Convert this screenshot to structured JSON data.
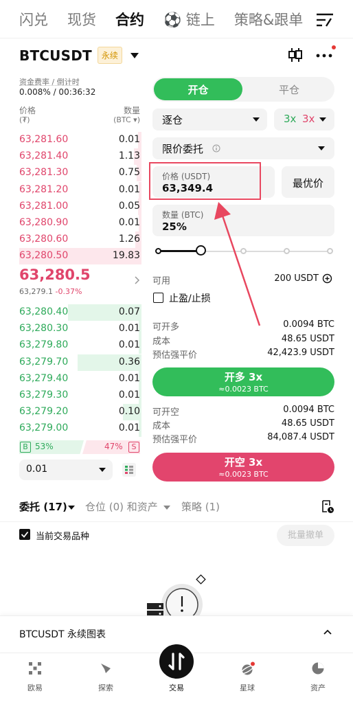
{
  "top_nav": {
    "tabs": [
      "闪兑",
      "现货",
      "合约",
      "⚽ 链上",
      "策略&跟单"
    ],
    "active_index": 2
  },
  "symbol": {
    "name": "BTCUSDT",
    "badge": "永续"
  },
  "funding": {
    "label": "资金费率 / 倒计时",
    "value": "0.008% / 00:36:32"
  },
  "orderbook": {
    "price_header": "价格",
    "price_unit": "(₮)",
    "qty_header": "数量",
    "qty_unit": "(BTC ▾)",
    "asks": [
      {
        "price": "63,281.60",
        "qty": "0.01",
        "depth": 0.03
      },
      {
        "price": "63,281.40",
        "qty": "1.13",
        "depth": 0.06
      },
      {
        "price": "63,281.30",
        "qty": "0.75",
        "depth": 0.04
      },
      {
        "price": "63,281.20",
        "qty": "0.01",
        "depth": 0.02
      },
      {
        "price": "63,281.00",
        "qty": "0.05",
        "depth": 0.03
      },
      {
        "price": "63,280.90",
        "qty": "0.01",
        "depth": 0.02
      },
      {
        "price": "63,280.60",
        "qty": "1.26",
        "depth": 0.05
      },
      {
        "price": "63,280.50",
        "qty": "19.83",
        "depth": 1.0
      }
    ],
    "last_price": "63,280.5",
    "mark_price": "63,279.1",
    "change": "-0.37%",
    "bids": [
      {
        "price": "63,280.40",
        "qty": "0.07",
        "depth": 0.6
      },
      {
        "price": "63,280.30",
        "qty": "0.01",
        "depth": 0.02
      },
      {
        "price": "63,279.80",
        "qty": "0.01",
        "depth": 0.02
      },
      {
        "price": "63,279.70",
        "qty": "0.36",
        "depth": 0.52
      },
      {
        "price": "63,279.40",
        "qty": "0.01",
        "depth": 0.02
      },
      {
        "price": "63,279.30",
        "qty": "0.01",
        "depth": 0.02
      },
      {
        "price": "63,279.20",
        "qty": "0.10",
        "depth": 0.15
      },
      {
        "price": "63,279.00",
        "qty": "0.01",
        "depth": 0.02
      }
    ],
    "buy_ratio": "53%",
    "sell_ratio": "47%",
    "buy_badge": "B",
    "sell_badge": "S",
    "precision": "0.01"
  },
  "order_form": {
    "open_tab": "开仓",
    "close_tab": "平仓",
    "margin_mode": "逐仓",
    "leverage_long": "3x",
    "leverage_short": "3x",
    "order_type": "限价委托",
    "price_label": "价格 (USDT)",
    "price_value": "63,349.4",
    "best_price": "最优价",
    "qty_label": "数量 (BTC)",
    "qty_value": "25%",
    "slider_fraction": 0.25,
    "available_label": "可用",
    "available_value": "200 USDT",
    "tpsl_label": "止盈/止损",
    "long": {
      "max_label": "可开多",
      "max_value": "0.0094 BTC",
      "cost_label": "成本",
      "cost_value": "48.65 USDT",
      "liq_label": "预估强平价",
      "liq_value": "42,423.9 USDT",
      "button_label": "开多 3x",
      "button_sub": "≈0.0023 BTC"
    },
    "short": {
      "max_label": "可开空",
      "max_value": "0.0094 BTC",
      "cost_label": "成本",
      "cost_value": "48.65 USDT",
      "liq_label": "预估强平价",
      "liq_value": "84,087.4 USDT",
      "button_label": "开空 3x",
      "button_sub": "≈0.0023 BTC"
    }
  },
  "bottom_tabs": {
    "orders": "委托 (17)",
    "positions": "仓位 (0) 和资产",
    "strategy": "策略 (1)",
    "current_only": "当前交易品种",
    "batch_cancel": "批量撤单"
  },
  "chart_bar": {
    "label": "BTCUSDT 永续图表"
  },
  "bottom_nav": {
    "items": [
      "欧易",
      "探索",
      "交易",
      "星球",
      "资产"
    ]
  },
  "colors": {
    "green": "#32bd5a",
    "red": "#e0456b",
    "annotation": "#e8475f"
  }
}
